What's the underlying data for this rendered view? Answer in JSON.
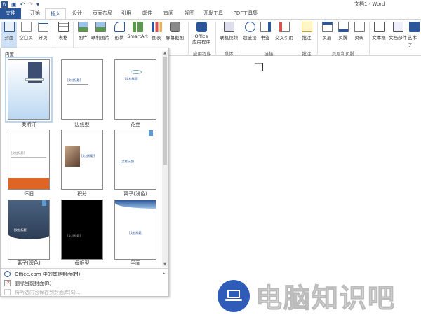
{
  "window": {
    "title": "文档1 - Word"
  },
  "tabs": [
    {
      "label": "文件"
    },
    {
      "label": "开始"
    },
    {
      "label": "插入"
    },
    {
      "label": "设计"
    },
    {
      "label": "页面布局"
    },
    {
      "label": "引用"
    },
    {
      "label": "邮件"
    },
    {
      "label": "审阅"
    },
    {
      "label": "视图"
    },
    {
      "label": "开发工具"
    },
    {
      "label": "PDF工具集"
    }
  ],
  "ribbon": {
    "buttons": [
      {
        "label": "封面"
      },
      {
        "label": "空白页"
      },
      {
        "label": "分页"
      },
      {
        "label": "表格"
      },
      {
        "label": "图片"
      },
      {
        "label": "联机图片"
      },
      {
        "label": "形状"
      },
      {
        "label": "SmartArt"
      },
      {
        "label": "图表"
      },
      {
        "label": "屏幕截图"
      },
      {
        "label": "Office\n应用程序"
      },
      {
        "label": "联机视频"
      },
      {
        "label": "超链接"
      },
      {
        "label": "书签"
      },
      {
        "label": "交叉引用"
      },
      {
        "label": "批注"
      },
      {
        "label": "页眉"
      },
      {
        "label": "页脚"
      },
      {
        "label": "页码"
      },
      {
        "label": "文本框"
      },
      {
        "label": "文档部件"
      },
      {
        "label": "艺术字"
      }
    ],
    "groups": [
      {
        "label": "应用程序"
      },
      {
        "label": "媒体"
      },
      {
        "label": "链接"
      },
      {
        "label": "批注"
      },
      {
        "label": "页眉和页脚"
      }
    ]
  },
  "gallery": {
    "heading": "内置",
    "items": [
      {
        "label": "奥斯汀"
      },
      {
        "label": "边线型"
      },
      {
        "label": "花丝"
      },
      {
        "label": "怀旧"
      },
      {
        "label": "积分"
      },
      {
        "label": "离子(浅色)"
      },
      {
        "label": "离子(深色)"
      },
      {
        "label": "母板型"
      },
      {
        "label": "平面"
      }
    ],
    "thumb_text": "[文档标题]"
  },
  "menu": {
    "more": "Office.com 中的其他封面(M)",
    "remove": "删除当前封面(R)",
    "save": "将所选内容保存到封面库(S)..."
  },
  "watermark": {
    "text": "电脑知识吧"
  },
  "colors": {
    "accent": "#2b579a",
    "selection": "#bcd4ee"
  }
}
